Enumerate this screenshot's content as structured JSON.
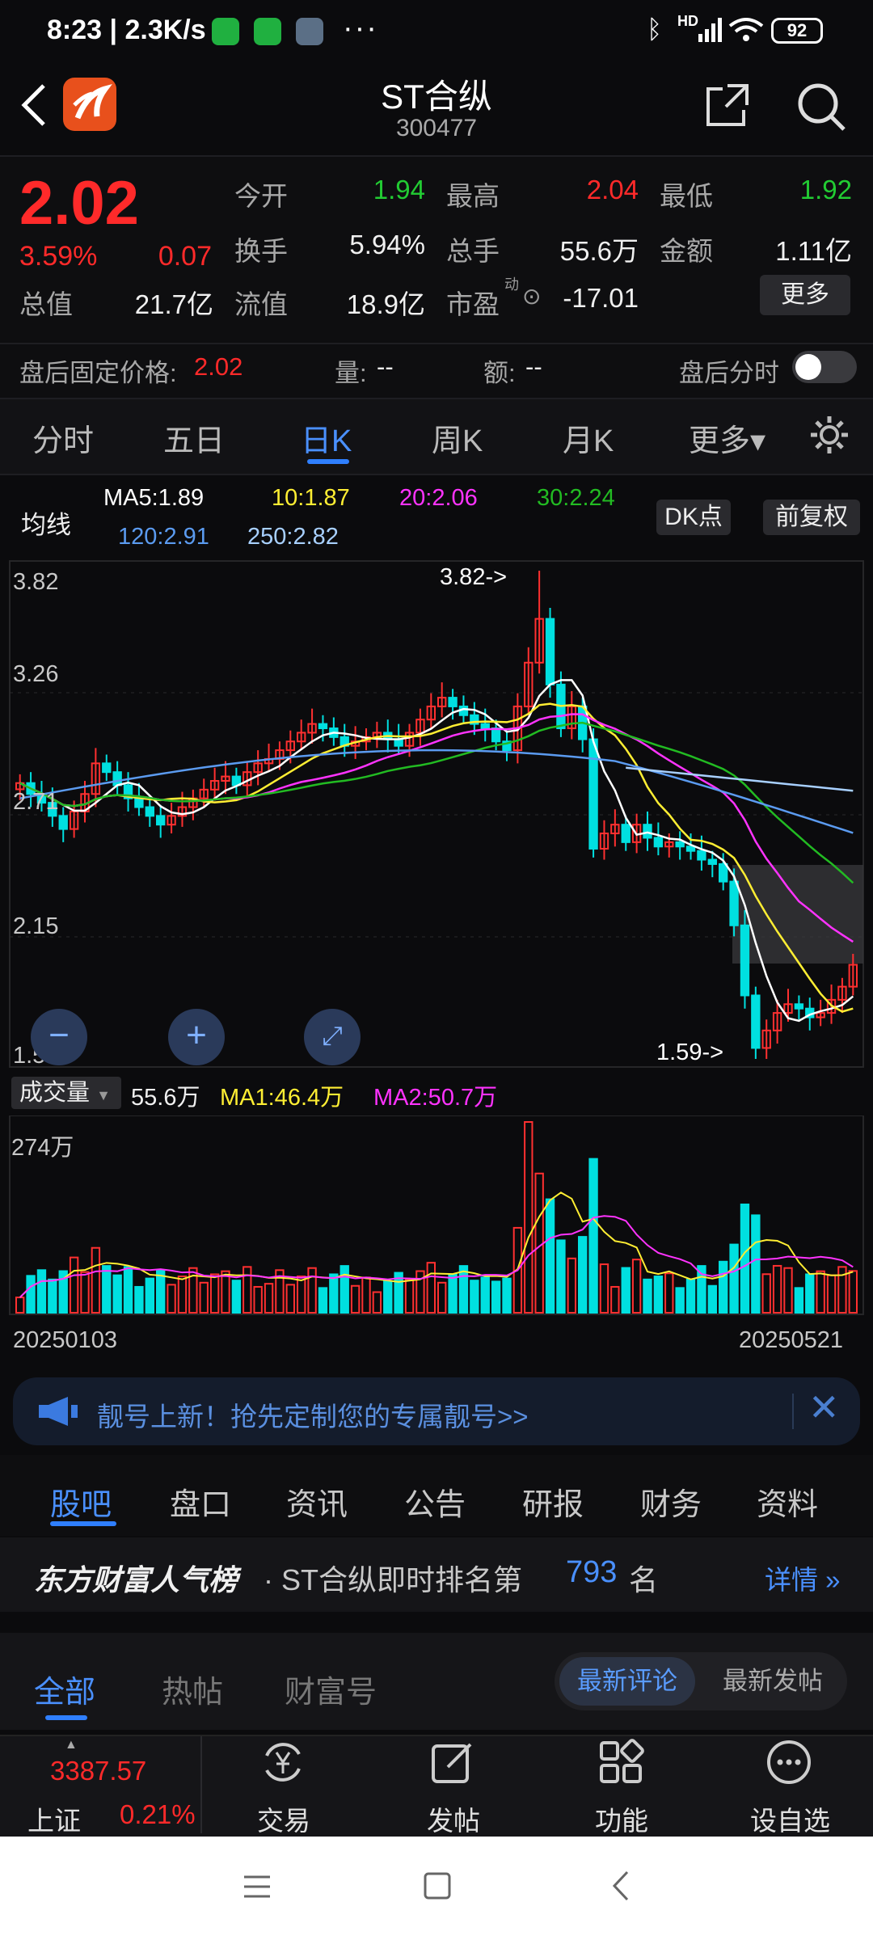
{
  "status_bar": {
    "time": "8:23",
    "speed": "2.3K/s",
    "more": "···",
    "net": "HD",
    "battery": "92"
  },
  "header": {
    "name": "ST合纵",
    "code": "300477"
  },
  "quote": {
    "price": "2.02",
    "change_pct": "3.59%",
    "change": "0.07",
    "rows": [
      [
        {
          "label": "今开",
          "value": "1.94",
          "color": "green"
        },
        {
          "label": "最高",
          "value": "2.04",
          "color": "red"
        },
        {
          "label": "最低",
          "value": "1.92",
          "color": "green"
        }
      ],
      [
        {
          "label": "换手",
          "value": "5.94%",
          "color": "white"
        },
        {
          "label": "总手",
          "value": "55.6万",
          "color": "white"
        },
        {
          "label": "金额",
          "value": "1.11亿",
          "color": "white"
        }
      ]
    ],
    "row3": {
      "total_label": "总值",
      "total_value": "21.7亿",
      "float_label": "流值",
      "float_value": "18.9亿",
      "pe_label": "市盈",
      "pe_sup": "动",
      "pe_value": "-17.01",
      "more": "更多"
    },
    "after_hours": {
      "label": "盘后固定价格:",
      "price": "2.02",
      "vol_label": "量:",
      "vol_value": "--",
      "amt_label": "额:",
      "amt_value": "--",
      "timeline_label": "盘后分时"
    }
  },
  "period_tabs": [
    "分时",
    "五日",
    "日K",
    "周K",
    "月K",
    "更多▾"
  ],
  "active_tab": "日K",
  "ma_legend": {
    "title": "均线",
    "items": [
      {
        "text": "MA5:1.89",
        "color": "#ffffff"
      },
      {
        "text": "10:1.87",
        "color": "#ffee33"
      },
      {
        "text": "20:2.06",
        "color": "#ff33ff"
      },
      {
        "text": "30:2.24",
        "color": "#22bb22"
      },
      {
        "text": "120:2.91",
        "color": "#5b9bf0"
      },
      {
        "text": "250:2.82",
        "color": "#a8d0ff"
      }
    ],
    "dk": "DK点",
    "adjust": "前复权"
  },
  "price_axis": [
    "3.82",
    "3.26",
    "2.71",
    "2.15",
    "1.59"
  ],
  "annotations": {
    "high": "3.82->",
    "low": "1.59->"
  },
  "volume": {
    "selector": "成交量",
    "value": "55.6万",
    "ma1": {
      "text": "MA1:46.4万",
      "color": "#ffee33"
    },
    "ma2": {
      "text": "MA2:50.7万",
      "color": "#ff33ff"
    },
    "axis_max": "274万",
    "start_date": "20250103",
    "end_date": "20250521"
  },
  "chart_data": {
    "type": "candlestick",
    "x_range": [
      "20250103",
      "20250521"
    ],
    "ylim": [
      1.59,
      3.82
    ],
    "high": 3.82,
    "low": 1.59,
    "last_close": 2.02,
    "close": [
      2.85,
      2.8,
      2.76,
      2.7,
      2.64,
      2.72,
      2.8,
      2.94,
      2.9,
      2.84,
      2.78,
      2.74,
      2.7,
      2.66,
      2.7,
      2.74,
      2.78,
      2.82,
      2.86,
      2.88,
      2.84,
      2.9,
      2.94,
      2.96,
      3.0,
      3.04,
      3.08,
      3.12,
      3.1,
      3.06,
      3.02,
      3.04,
      3.06,
      3.08,
      3.05,
      3.02,
      3.08,
      3.14,
      3.2,
      3.24,
      3.2,
      3.16,
      3.12,
      3.1,
      3.04,
      3.0,
      3.2,
      3.4,
      3.6,
      3.3,
      3.1,
      3.2,
      3.05,
      2.55,
      2.62,
      2.66,
      2.58,
      2.66,
      2.6,
      2.56,
      2.58,
      2.56,
      2.54,
      2.5,
      2.48,
      2.4,
      2.2,
      1.88,
      1.64,
      1.72,
      1.8,
      1.84,
      1.82,
      1.78,
      1.8,
      1.86,
      1.92,
      2.02
    ]
  },
  "banner": {
    "text": "靓号上新！抢先定制您的专属靓号>>"
  },
  "sub_tabs": [
    "股吧",
    "盘口",
    "资讯",
    "公告",
    "研报",
    "财务",
    "资料"
  ],
  "active_sub_tab": "股吧",
  "rank": {
    "brand": "东方财富人气榜",
    "prefix": "· ST合纵即时排名第",
    "number": "793",
    "suffix": "名",
    "detail": "详情"
  },
  "feed_tabs": [
    "全部",
    "热帖",
    "财富号"
  ],
  "feed_sort": [
    "最新评论",
    "最新发帖"
  ],
  "index": {
    "value": "3387.57",
    "name": "上证",
    "pct": "0.21%"
  },
  "toolbar": [
    "交易",
    "发帖",
    "功能",
    "设自选"
  ]
}
